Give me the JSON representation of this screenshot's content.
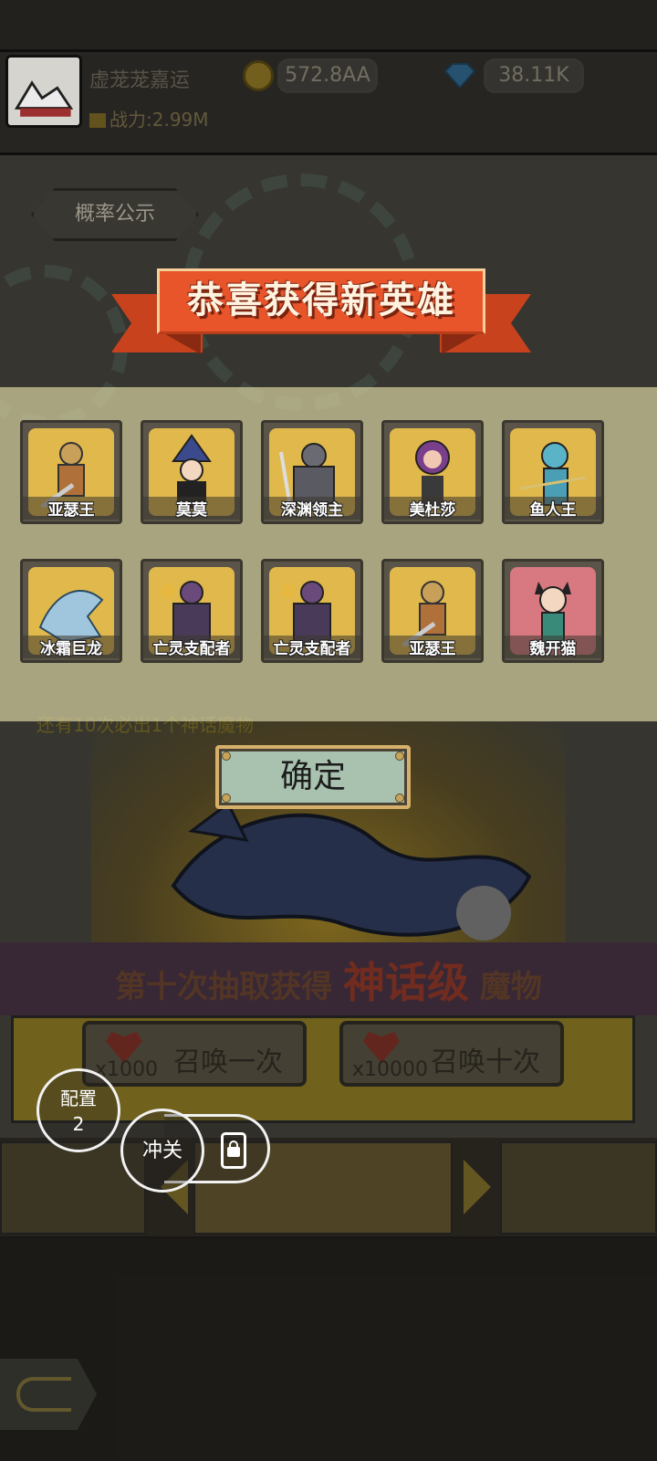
{
  "player": {
    "name": "虚茏茏嘉运",
    "power": "战力:2.99M",
    "coins": "572.8AA",
    "gems": "38.11K"
  },
  "probability_button": "概率公示",
  "result": {
    "title": "恭喜获得新英雄",
    "heroes": [
      {
        "name": "亚瑟王"
      },
      {
        "name": "莫莫"
      },
      {
        "name": "深渊领主"
      },
      {
        "name": "美杜莎"
      },
      {
        "name": "鱼人王"
      },
      {
        "name": "冰霜巨龙"
      },
      {
        "name": "亡灵支配者"
      },
      {
        "name": "亡灵支配者"
      },
      {
        "name": "亚瑟王"
      },
      {
        "name": "魏开猫"
      }
    ],
    "confirm_label": "确定"
  },
  "pity_text": "还有10次必出1个神话魔物",
  "banner": {
    "prefix": "第十次抽取获得",
    "highlight": "神话级",
    "suffix": "魔物"
  },
  "summon": {
    "once_label": "召唤一次",
    "once_cost": "x1000",
    "ten_label": "召唤十次",
    "ten_cost": "x10000"
  },
  "floating": {
    "config_label": "配置",
    "config_number": "2",
    "rush_label": "冲关"
  },
  "colors": {
    "ribbon": "#e8552b",
    "card_gold": "#e0b84c",
    "card_pink": "#d87880",
    "confirm_bg": "#a9c2b0"
  }
}
